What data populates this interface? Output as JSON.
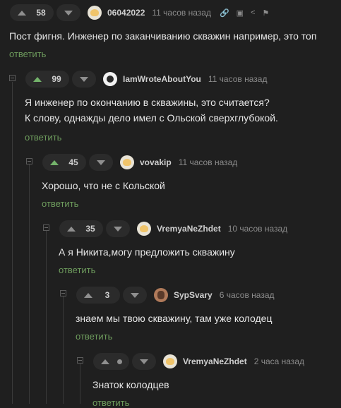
{
  "comments": [
    {
      "score": "58",
      "up_color": "gray",
      "user": "06042022",
      "time": "11 часов назад",
      "avatar": "avatar",
      "text_lines": [
        "Пост фигня. Инженер по заканчиванию скважин например, это топ"
      ],
      "reply": "ответить"
    },
    {
      "score": "99",
      "up_color": "green",
      "user": "IamWroteAboutYou",
      "time": "11 часов назад",
      "avatar": "avatar-dark",
      "text_lines": [
        "Я инженер по окончанию в скважины, это считается?",
        "К слову, однажды дело имел с Ольской сверхглубокой."
      ],
      "reply": "ответить"
    },
    {
      "score": "45",
      "up_color": "green",
      "user": "vovakip",
      "time": "11 часов назад",
      "avatar": "avatar",
      "text_lines": [
        "Хорошо, что не с Кольской"
      ],
      "reply": "ответить"
    },
    {
      "score": "35",
      "up_color": "gray",
      "user": "VremyaNeZhdet",
      "time": "10 часов назад",
      "avatar": "avatar",
      "text_lines": [
        "А я Никита,могу предложить скважину"
      ],
      "reply": "ответить"
    },
    {
      "score": "3",
      "up_color": "gray",
      "user": "SypSvary",
      "time": "6 часов назад",
      "avatar": "avatar-person",
      "text_lines": [
        "знаем мы твою скважину, там уже колодец"
      ],
      "reply": "ответить"
    },
    {
      "score": "",
      "up_color": "gray",
      "user": "VremyaNeZhdet",
      "time": "2 часа назад",
      "avatar": "avatar",
      "text_lines": [
        "Знаток колодцев"
      ],
      "reply": "ответить"
    }
  ],
  "toolbar_icons": [
    "link-icon",
    "save-icon",
    "share-icon",
    "flag-icon"
  ]
}
